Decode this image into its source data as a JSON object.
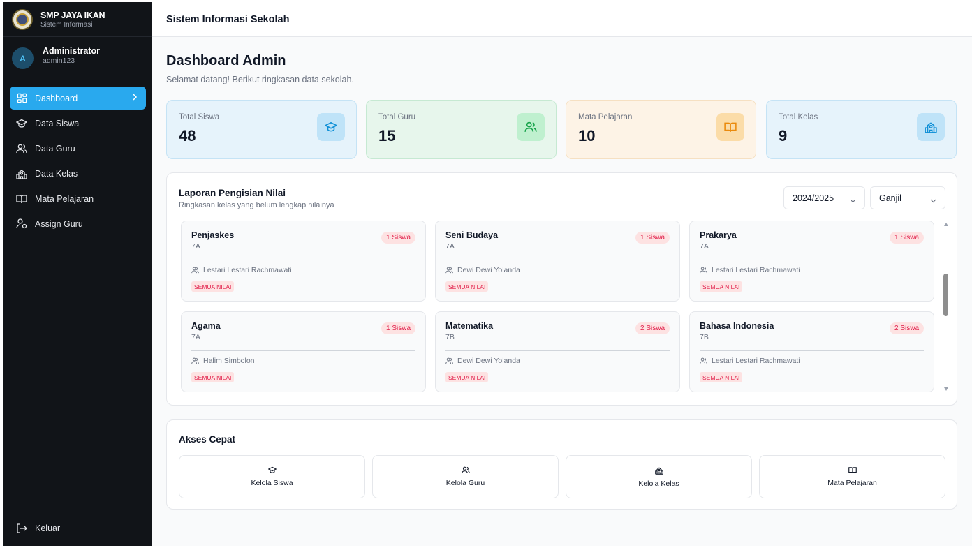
{
  "brand": {
    "title": "SMP JAYA IKAN",
    "subtitle": "Sistem Informasi"
  },
  "user": {
    "initial": "A",
    "name": "Administrator",
    "username": "admin123"
  },
  "nav": [
    {
      "label": "Dashboard",
      "icon": "dashboard-icon",
      "active": true
    },
    {
      "label": "Data Siswa",
      "icon": "graduation-cap-icon"
    },
    {
      "label": "Data Guru",
      "icon": "users-icon"
    },
    {
      "label": "Data Kelas",
      "icon": "school-icon"
    },
    {
      "label": "Mata Pelajaran",
      "icon": "book-icon"
    },
    {
      "label": "Assign Guru",
      "icon": "user-assign-icon"
    }
  ],
  "logout_label": "Keluar",
  "topbar": {
    "title": "Sistem Informasi Sekolah"
  },
  "page": {
    "title": "Dashboard Admin",
    "subtitle": "Selamat datang! Berikut ringkasan data sekolah."
  },
  "stats": [
    {
      "label": "Total Siswa",
      "value": "48",
      "icon": "graduation-cap-icon",
      "bg": "#e6f3fb",
      "border": "#c5e3f5",
      "icon_bg": "#bfe3f8",
      "icon_color": "#0e8fd6"
    },
    {
      "label": "Total Guru",
      "value": "15",
      "icon": "users-icon",
      "bg": "#e7f6ec",
      "border": "#c6e9d2",
      "icon_bg": "#bff0cf",
      "icon_color": "#16a34a"
    },
    {
      "label": "Mata Pelajaran",
      "value": "10",
      "icon": "book-icon",
      "bg": "#fdf3e6",
      "border": "#f6e0c2",
      "icon_bg": "#fbdca8",
      "icon_color": "#ea8a0c"
    },
    {
      "label": "Total Kelas",
      "value": "9",
      "icon": "school-icon",
      "bg": "#e6f3fb",
      "border": "#c5e3f5",
      "icon_bg": "#bfe3f8",
      "icon_color": "#0e8fd6"
    }
  ],
  "report": {
    "title": "Laporan Pengisian Nilai",
    "subtitle": "Ringkasan kelas yang belum lengkap nilainya",
    "year_select": "2024/2025",
    "semester_select": "Ganjil",
    "cards": [
      {
        "subject": "Penjaskes",
        "class": "7A",
        "badge": "1 Siswa",
        "teacher": "Lestari Lestari Rachmawati",
        "tag": "SEMUA NILAI"
      },
      {
        "subject": "Seni Budaya",
        "class": "7A",
        "badge": "1 Siswa",
        "teacher": "Dewi Dewi Yolanda",
        "tag": "SEMUA NILAI"
      },
      {
        "subject": "Prakarya",
        "class": "7A",
        "badge": "1 Siswa",
        "teacher": "Lestari Lestari Rachmawati",
        "tag": "SEMUA NILAI"
      },
      {
        "subject": "Agama",
        "class": "7A",
        "badge": "1 Siswa",
        "teacher": "Halim Simbolon",
        "tag": "SEMUA NILAI"
      },
      {
        "subject": "Matematika",
        "class": "7B",
        "badge": "2 Siswa",
        "teacher": "Dewi Dewi Yolanda",
        "tag": "SEMUA NILAI"
      },
      {
        "subject": "Bahasa Indonesia",
        "class": "7B",
        "badge": "2 Siswa",
        "teacher": "Lestari Lestari Rachmawati",
        "tag": "SEMUA NILAI"
      }
    ]
  },
  "quick": {
    "title": "Akses Cepat",
    "items": [
      {
        "label": "Kelola Siswa",
        "icon": "graduation-cap-icon"
      },
      {
        "label": "Kelola Guru",
        "icon": "users-icon"
      },
      {
        "label": "Kelola Kelas",
        "icon": "school-icon"
      },
      {
        "label": "Mata Pelajaran",
        "icon": "book-icon"
      }
    ]
  }
}
